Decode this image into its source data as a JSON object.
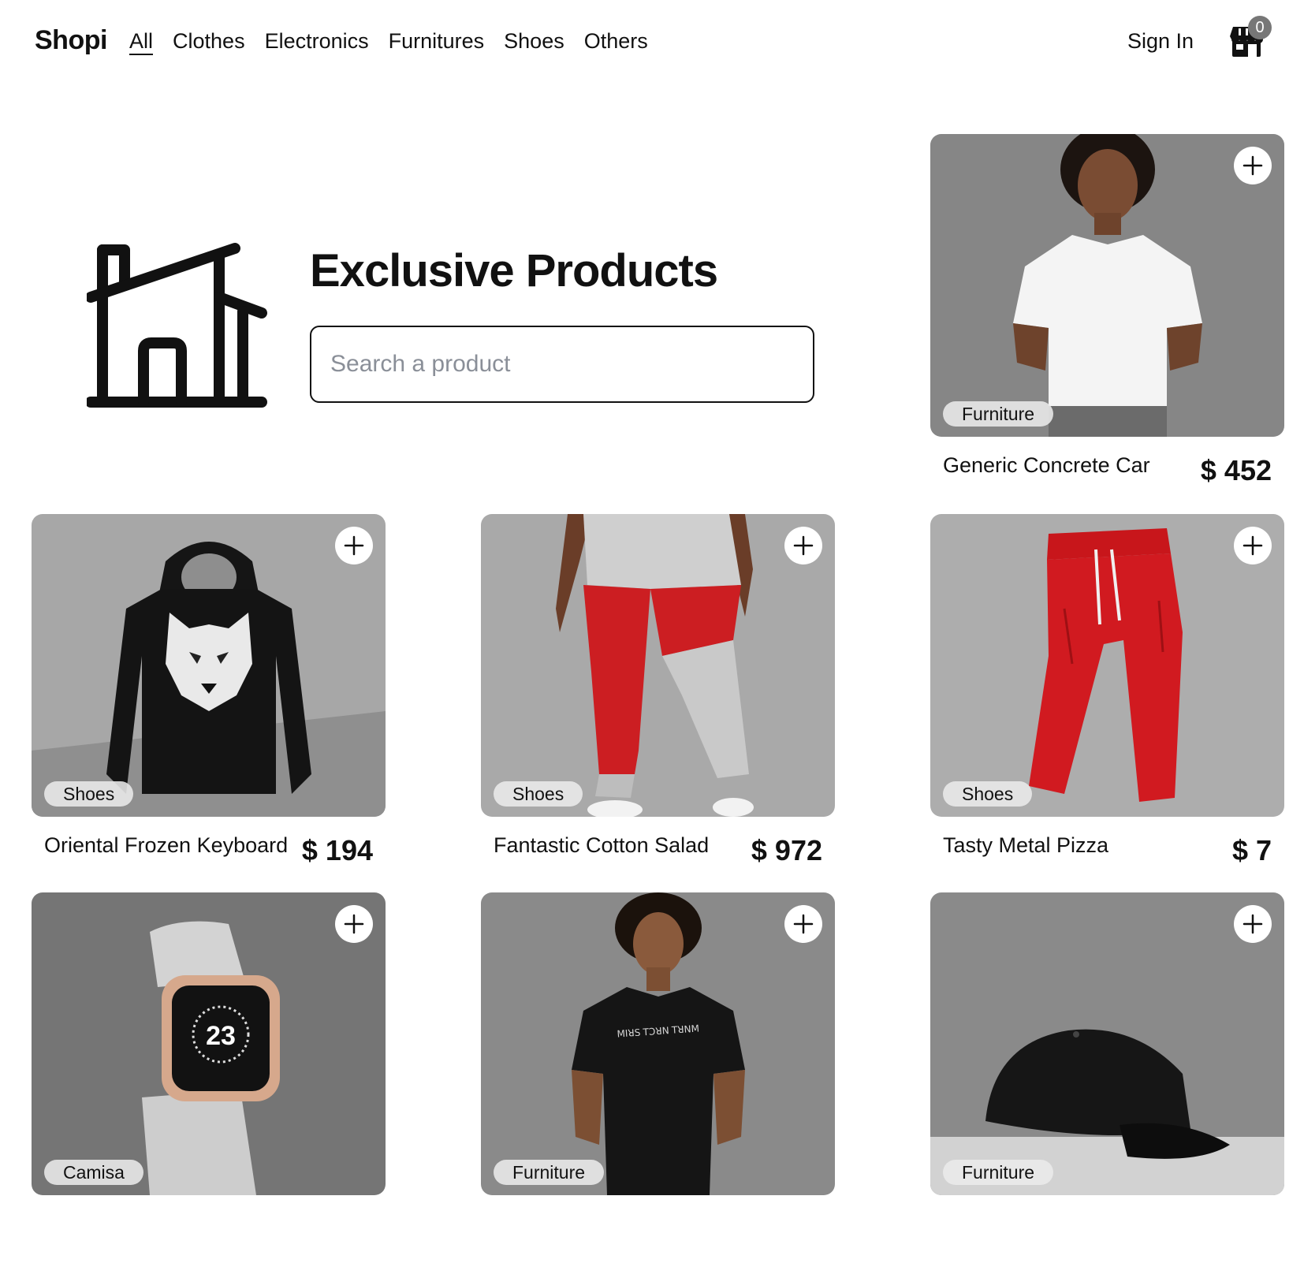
{
  "navbar": {
    "brand": "Shopi",
    "links": [
      {
        "label": "All",
        "active": true
      },
      {
        "label": "Clothes",
        "active": false
      },
      {
        "label": "Electronics",
        "active": false
      },
      {
        "label": "Furnitures",
        "active": false
      },
      {
        "label": "Shoes",
        "active": false
      },
      {
        "label": "Others",
        "active": false
      }
    ],
    "sign_in": "Sign In",
    "cart_icon": "storefront-icon",
    "cart_count": "0"
  },
  "hero": {
    "icon": "house-icon",
    "title": "Exclusive Products",
    "search_placeholder": "Search a product",
    "search_value": ""
  },
  "products": [
    {
      "name": "Generic Concrete Car",
      "price": "$ 452",
      "category": "Furniture",
      "image": "woman-white-tshirt"
    },
    {
      "name": "Oriental Frozen Keyboard",
      "price": "$ 194",
      "category": "Shoes",
      "image": "black-wolf-hoodie"
    },
    {
      "name": "Fantastic Cotton Salad",
      "price": "$ 972",
      "category": "Shoes",
      "image": "red-grey-joggers"
    },
    {
      "name": "Tasty Metal Pizza",
      "price": "$ 7",
      "category": "Shoes",
      "image": "red-sweatpants"
    },
    {
      "name": "",
      "price": "",
      "category": "Camisa",
      "image": "smartwatch"
    },
    {
      "name": "",
      "price": "",
      "category": "Furniture",
      "image": "woman-black-tshirt"
    },
    {
      "name": "",
      "price": "",
      "category": "Furniture",
      "image": "black-cap"
    }
  ],
  "colors": {
    "text": "#111111",
    "background": "#ffffff",
    "badge": "#ebebeb",
    "placeholder": "#8a8f98",
    "product_red": "#c8161b"
  }
}
